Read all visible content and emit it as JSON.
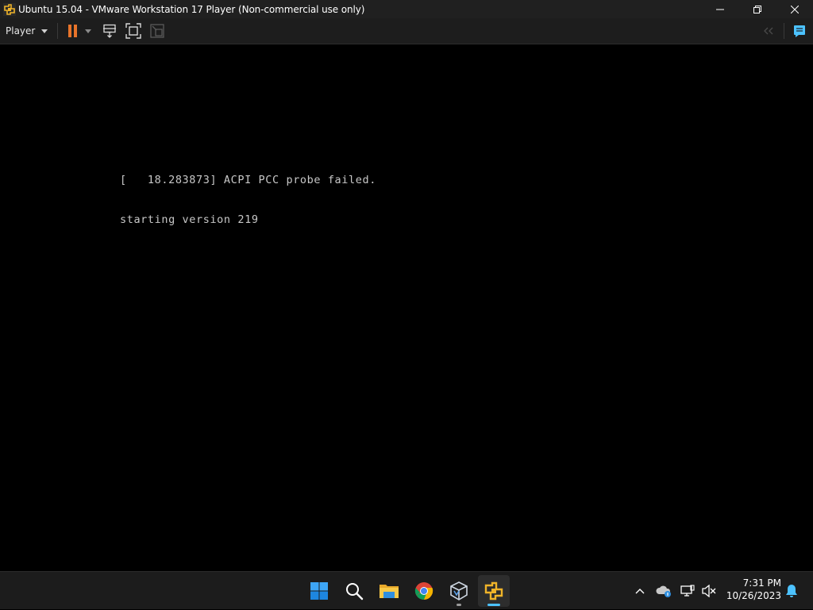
{
  "window": {
    "title": "Ubuntu 15.04 - VMware Workstation 17 Player (Non-commercial use only)"
  },
  "toolbar": {
    "player_menu_label": "Player",
    "icons": [
      "pause-icon",
      "send-ctrl-alt-del-icon",
      "fit-guest-icon",
      "unity-icon",
      "back-icon",
      "message-log-icon"
    ]
  },
  "console": {
    "lines": [
      "[   18.283873] ACPI PCC probe failed.",
      "starting version 219"
    ]
  },
  "taskbar": {
    "apps": [
      "windows-start-icon",
      "search-icon",
      "file-explorer-icon",
      "chrome-icon",
      "virtualbox-icon",
      "vmware-icon"
    ],
    "time": "7:31 PM",
    "date": "10/26/2023"
  },
  "colors": {
    "titlebar_bg": "#202020",
    "toolbar_bg": "#1d1d1d",
    "pause_orange": "#e8742a",
    "taskbar_bg": "#1c1c1c",
    "accent_blue": "#4cc2ff"
  }
}
